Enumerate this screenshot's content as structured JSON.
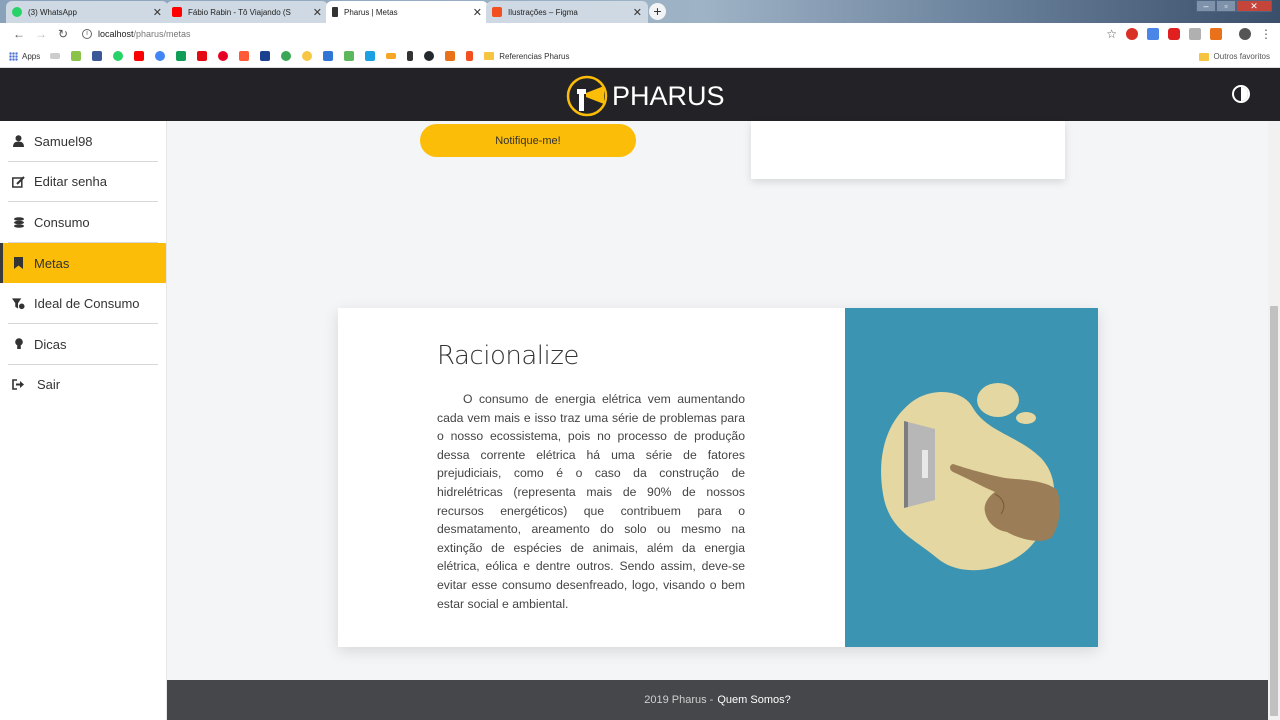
{
  "browser": {
    "tabs": [
      {
        "title": "(3) WhatsApp",
        "favicon_color": "#25d366"
      },
      {
        "title": "Fábio Rabin - Tô Viajando (S",
        "favicon_color": "#ff0000"
      },
      {
        "title": "Pharus | Metas",
        "favicon_color": "#333333"
      },
      {
        "title": "Ilustrações – Figma",
        "favicon_color": "#f24e1e"
      }
    ],
    "new_tab": "+",
    "url_host": "localhost",
    "url_path": "/pharus/metas",
    "bookmarks_apps": "Apps",
    "bookmark_folder": "Referencias Pharus",
    "other_bookmarks": "Outros favoritos"
  },
  "header": {
    "logo_text": "PHARUS"
  },
  "sidebar": {
    "items": [
      {
        "label": "Samuel98",
        "icon": "user-icon"
      },
      {
        "label": "Editar senha",
        "icon": "edit-icon"
      },
      {
        "label": "Consumo",
        "icon": "coins-icon"
      },
      {
        "label": "Metas",
        "icon": "bookmark-icon"
      },
      {
        "label": "Ideal de Consumo",
        "icon": "filter-icon"
      },
      {
        "label": "Dicas",
        "icon": "lightbulb-icon"
      },
      {
        "label": "Sair",
        "icon": "sign-out-icon"
      }
    ]
  },
  "main": {
    "notify_button": "Notifique-me!",
    "card_title": "Racionalize",
    "card_text": "O consumo de energia elétrica vem aumentando cada vem mais e isso traz uma série de problemas para o nosso ecossistema, pois no processo de produção dessa corrente elétrica há uma série de fatores prejudiciais, como é o caso da construção de hidrelétricas (representa mais de 90% de nossos recursos energéticos) que contribuem para o desmatamento, areamento do solo ou mesmo na extinção de espécies de animais, além da energia elétrica, eólica e dentre outros. Sendo assim, deve-se evitar esse consumo desenfreado, logo, visando o bem estar social e ambiental."
  },
  "footer": {
    "copyright": "2019 Pharus -",
    "link": "Quem Somos?"
  },
  "colors": {
    "accent": "#fbbd08",
    "header_bg": "#232327",
    "footer_bg": "#45474b",
    "illustration_bg": "#3b94b1"
  }
}
